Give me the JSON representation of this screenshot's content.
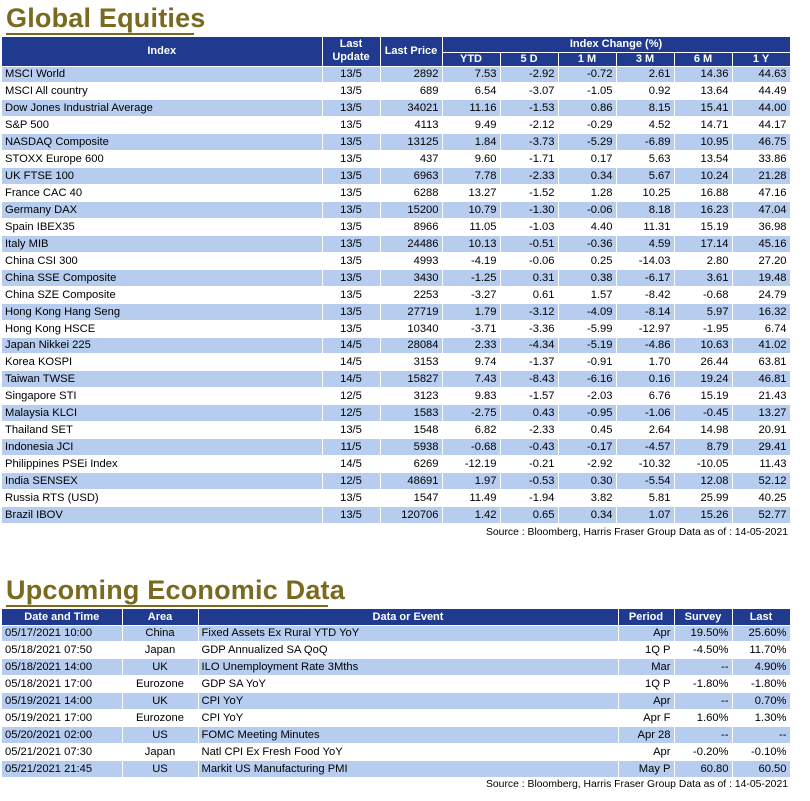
{
  "equities": {
    "title": "Global Equities",
    "headers": {
      "index": "Index",
      "last_update": "Last Update",
      "last_price": "Last Price",
      "index_change": "Index Change (%)",
      "ytd": "YTD",
      "d5": "5 D",
      "m1": "1 M",
      "m3": "3 M",
      "m6": "6 M",
      "y1": "1 Y"
    },
    "rows": [
      [
        "MSCI World",
        "13/5",
        "2892",
        "7.53",
        "-2.92",
        "-0.72",
        "2.61",
        "14.36",
        "44.63"
      ],
      [
        "MSCI All country",
        "13/5",
        "689",
        "6.54",
        "-3.07",
        "-1.05",
        "0.92",
        "13.64",
        "44.49"
      ],
      [
        "Dow Jones Industrial Average",
        "13/5",
        "34021",
        "11.16",
        "-1.53",
        "0.86",
        "8.15",
        "15.41",
        "44.00"
      ],
      [
        "S&P 500",
        "13/5",
        "4113",
        "9.49",
        "-2.12",
        "-0.29",
        "4.52",
        "14.71",
        "44.17"
      ],
      [
        "NASDAQ Composite",
        "13/5",
        "13125",
        "1.84",
        "-3.73",
        "-5.29",
        "-6.89",
        "10.95",
        "46.75"
      ],
      [
        "STOXX Europe 600",
        "13/5",
        "437",
        "9.60",
        "-1.71",
        "0.17",
        "5.63",
        "13.54",
        "33.86"
      ],
      [
        "UK FTSE 100",
        "13/5",
        "6963",
        "7.78",
        "-2.33",
        "0.34",
        "5.67",
        "10.24",
        "21.28"
      ],
      [
        "France CAC 40",
        "13/5",
        "6288",
        "13.27",
        "-1.52",
        "1.28",
        "10.25",
        "16.88",
        "47.16"
      ],
      [
        "Germany DAX",
        "13/5",
        "15200",
        "10.79",
        "-1.30",
        "-0.06",
        "8.18",
        "16.23",
        "47.04"
      ],
      [
        "Spain IBEX35",
        "13/5",
        "8966",
        "11.05",
        "-1.03",
        "4.40",
        "11.31",
        "15.19",
        "36.98"
      ],
      [
        "Italy MIB",
        "13/5",
        "24486",
        "10.13",
        "-0.51",
        "-0.36",
        "4.59",
        "17.14",
        "45.16"
      ],
      [
        "China CSI 300",
        "13/5",
        "4993",
        "-4.19",
        "-0.06",
        "0.25",
        "-14.03",
        "2.80",
        "27.20"
      ],
      [
        "China SSE Composite",
        "13/5",
        "3430",
        "-1.25",
        "0.31",
        "0.38",
        "-6.17",
        "3.61",
        "19.48"
      ],
      [
        "China SZE Composite",
        "13/5",
        "2253",
        "-3.27",
        "0.61",
        "1.57",
        "-8.42",
        "-0.68",
        "24.79"
      ],
      [
        "Hong Kong Hang Seng",
        "13/5",
        "27719",
        "1.79",
        "-3.12",
        "-4.09",
        "-8.14",
        "5.97",
        "16.32"
      ],
      [
        "Hong Kong HSCE",
        "13/5",
        "10340",
        "-3.71",
        "-3.36",
        "-5.99",
        "-12.97",
        "-1.95",
        "6.74"
      ],
      [
        "Japan Nikkei 225",
        "14/5",
        "28084",
        "2.33",
        "-4.34",
        "-5.19",
        "-4.86",
        "10.63",
        "41.02"
      ],
      [
        "Korea KOSPI",
        "14/5",
        "3153",
        "9.74",
        "-1.37",
        "-0.91",
        "1.70",
        "26.44",
        "63.81"
      ],
      [
        "Taiwan TWSE",
        "14/5",
        "15827",
        "7.43",
        "-8.43",
        "-6.16",
        "0.16",
        "19.24",
        "46.81"
      ],
      [
        "Singapore STI",
        "12/5",
        "3123",
        "9.83",
        "-1.57",
        "-2.03",
        "6.76",
        "15.19",
        "21.43"
      ],
      [
        "Malaysia KLCI",
        "12/5",
        "1583",
        "-2.75",
        "0.43",
        "-0.95",
        "-1.06",
        "-0.45",
        "13.27"
      ],
      [
        "Thailand SET",
        "13/5",
        "1548",
        "6.82",
        "-2.33",
        "0.45",
        "2.64",
        "14.98",
        "20.91"
      ],
      [
        "Indonesia JCI",
        "11/5",
        "5938",
        "-0.68",
        "-0.43",
        "-0.17",
        "-4.57",
        "8.79",
        "29.41"
      ],
      [
        "Philippines PSEi Index",
        "14/5",
        "6269",
        "-12.19",
        "-0.21",
        "-2.92",
        "-10.32",
        "-10.05",
        "11.43"
      ],
      [
        "India SENSEX",
        "12/5",
        "48691",
        "1.97",
        "-0.53",
        "0.30",
        "-5.54",
        "12.08",
        "52.12"
      ],
      [
        "Russia RTS (USD)",
        "13/5",
        "1547",
        "11.49",
        "-1.94",
        "3.82",
        "5.81",
        "25.99",
        "40.25"
      ],
      [
        "Brazil IBOV",
        "13/5",
        "120706",
        "1.42",
        "0.65",
        "0.34",
        "1.07",
        "15.26",
        "52.77"
      ]
    ],
    "source": "Source : Bloomberg, Harris Fraser Group Data as of : 14-05-2021"
  },
  "economic": {
    "title": "Upcoming Economic Data",
    "headers": {
      "date_time": "Date and Time",
      "area": "Area",
      "event": "Data or Event",
      "period": "Period",
      "survey": "Survey",
      "last": "Last"
    },
    "rows": [
      [
        "05/17/2021 10:00",
        "China",
        "Fixed Assets Ex Rural YTD YoY",
        "Apr",
        "19.50%",
        "25.60%"
      ],
      [
        "05/18/2021 07:50",
        "Japan",
        "GDP Annualized SA QoQ",
        "1Q P",
        "-4.50%",
        "11.70%"
      ],
      [
        "05/18/2021 14:00",
        "UK",
        "ILO Unemployment Rate 3Mths",
        "Mar",
        "--",
        "4.90%"
      ],
      [
        "05/18/2021 17:00",
        "Eurozone",
        "GDP SA YoY",
        "1Q P",
        "-1.80%",
        "-1.80%"
      ],
      [
        "05/19/2021 14:00",
        "UK",
        "CPI YoY",
        "Apr",
        "--",
        "0.70%"
      ],
      [
        "05/19/2021 17:00",
        "Eurozone",
        "CPI YoY",
        "Apr F",
        "1.60%",
        "1.30%"
      ],
      [
        "05/20/2021 02:00",
        "US",
        "FOMC Meeting Minutes",
        "Apr 28",
        "--",
        "--"
      ],
      [
        "05/21/2021 07:30",
        "Japan",
        "Natl CPI Ex Fresh Food YoY",
        "Apr",
        "-0.20%",
        "-0.10%"
      ],
      [
        "05/21/2021 21:45",
        "US",
        "Markit US Manufacturing PMI",
        "May P",
        "60.80",
        "60.50"
      ]
    ],
    "source": "Source : Bloomberg, Harris Fraser Group Data as of : 14-05-2021"
  },
  "colors": {
    "header_bg": "#1f3a8f",
    "band_bg": "#b6cdef",
    "title": "#7a6a1f"
  }
}
